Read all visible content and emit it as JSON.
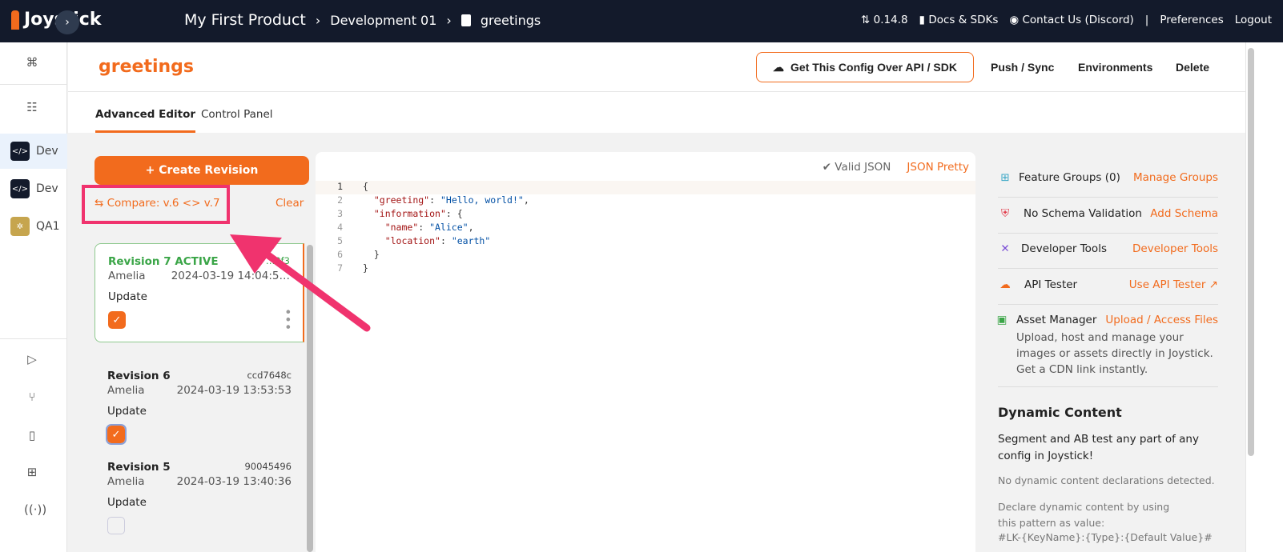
{
  "topbar": {
    "brand": "Joystick",
    "crumbs": [
      "My First Product",
      "Development 01",
      "greetings"
    ],
    "version": "0.14.8",
    "docs": "Docs & SDKs",
    "contact": "Contact Us (Discord)",
    "sep": "|",
    "preferences": "Preferences",
    "logout": "Logout"
  },
  "sidebar": {
    "envs": [
      {
        "label": "Dev",
        "icon": "code-icon",
        "selected": true
      },
      {
        "label": "Dev",
        "icon": "code-icon"
      },
      {
        "label": "QA1",
        "icon": "bug-icon"
      }
    ]
  },
  "header": {
    "title": "greetings",
    "api_button": "Get This Config Over API / SDK",
    "push": "Push / Sync",
    "environments": "Environments",
    "delete": "Delete"
  },
  "tabs": [
    "Advanced Editor",
    "Control Panel"
  ],
  "revisions": {
    "create": "+ Create Revision",
    "compare": "Compare: v.6 <> v.7",
    "clear": "Clear",
    "items": [
      {
        "name": "Revision 7 ACTIVE",
        "hash": "…2f3",
        "author": "Amelia",
        "date": "2024-03-19 14:04:5…",
        "message": "Update",
        "checked": true
      },
      {
        "name": "Revision 6",
        "hash": "ccd7648c",
        "author": "Amelia",
        "date": "2024-03-19 13:53:53",
        "message": "Update",
        "checked": true
      },
      {
        "name": "Revision 5",
        "hash": "90045496",
        "author": "Amelia",
        "date": "2024-03-19 13:40:36",
        "message": "Update",
        "checked": false
      }
    ]
  },
  "editor": {
    "valid": "✔ Valid JSON",
    "pretty": "JSON Pretty",
    "lines": [
      "1",
      "2",
      "3",
      "4",
      "5",
      "6",
      "7"
    ]
  },
  "right": {
    "feature_groups": "Feature Groups (0)",
    "manage_groups": "Manage Groups",
    "schema": "No Schema Validation",
    "add_schema": "Add Schema",
    "dev_tools": "Developer Tools",
    "dev_tools_link": "Developer Tools",
    "api_tester": "API Tester",
    "use_api_tester": "Use API Tester ↗",
    "asset_manager": "Asset Manager",
    "upload": "Upload / Access Files",
    "asset_desc": "Upload, host and manage your images or assets directly in Joystick. Get a CDN link instantly.",
    "dyn_title": "Dynamic Content",
    "dyn_sub": "Segment and AB test any part of any config in Joystick!",
    "dyn_none": "No dynamic content declarations detected.",
    "dyn_declare": "Declare dynamic content by using this pattern as value:",
    "dyn_pattern": "#LK-{KeyName}:{Type}:{Default Value}#"
  },
  "colors": {
    "accent": "#f26b1d",
    "topbar": "#131a2b",
    "annotation": "#f0336e",
    "active": "#3aa547"
  }
}
